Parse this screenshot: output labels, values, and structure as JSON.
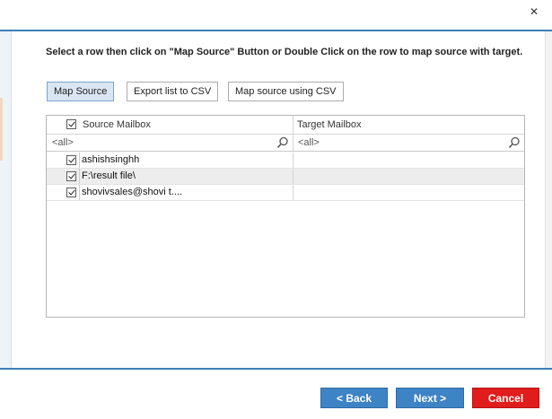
{
  "window": {
    "close_glyph": "✕"
  },
  "instruction": "Select a row then click on \"Map Source\" Button or Double Click on the row to map source with target.",
  "toolbar": {
    "map_source": "Map Source",
    "export_csv": "Export list to CSV",
    "map_using_csv": "Map source using CSV"
  },
  "grid": {
    "columns": {
      "source": "Source Mailbox",
      "target": "Target Mailbox"
    },
    "filters": {
      "source": "<all>",
      "target": "<all>"
    },
    "rows": [
      {
        "source": "ashishsinghh",
        "target": "",
        "checked": true
      },
      {
        "source": "F:\\result file\\",
        "target": "",
        "checked": true
      },
      {
        "source": "shovivsales@shovi                               t....",
        "target": "",
        "checked": true
      }
    ]
  },
  "footer": {
    "back": "< Back",
    "next": "Next >",
    "cancel": "Cancel"
  },
  "colors": {
    "accent_rule": "#3d7fb8",
    "button_blue": "#3e83c4",
    "button_red": "#e01c1c",
    "selected_tab_bg": "#dae6f3"
  }
}
